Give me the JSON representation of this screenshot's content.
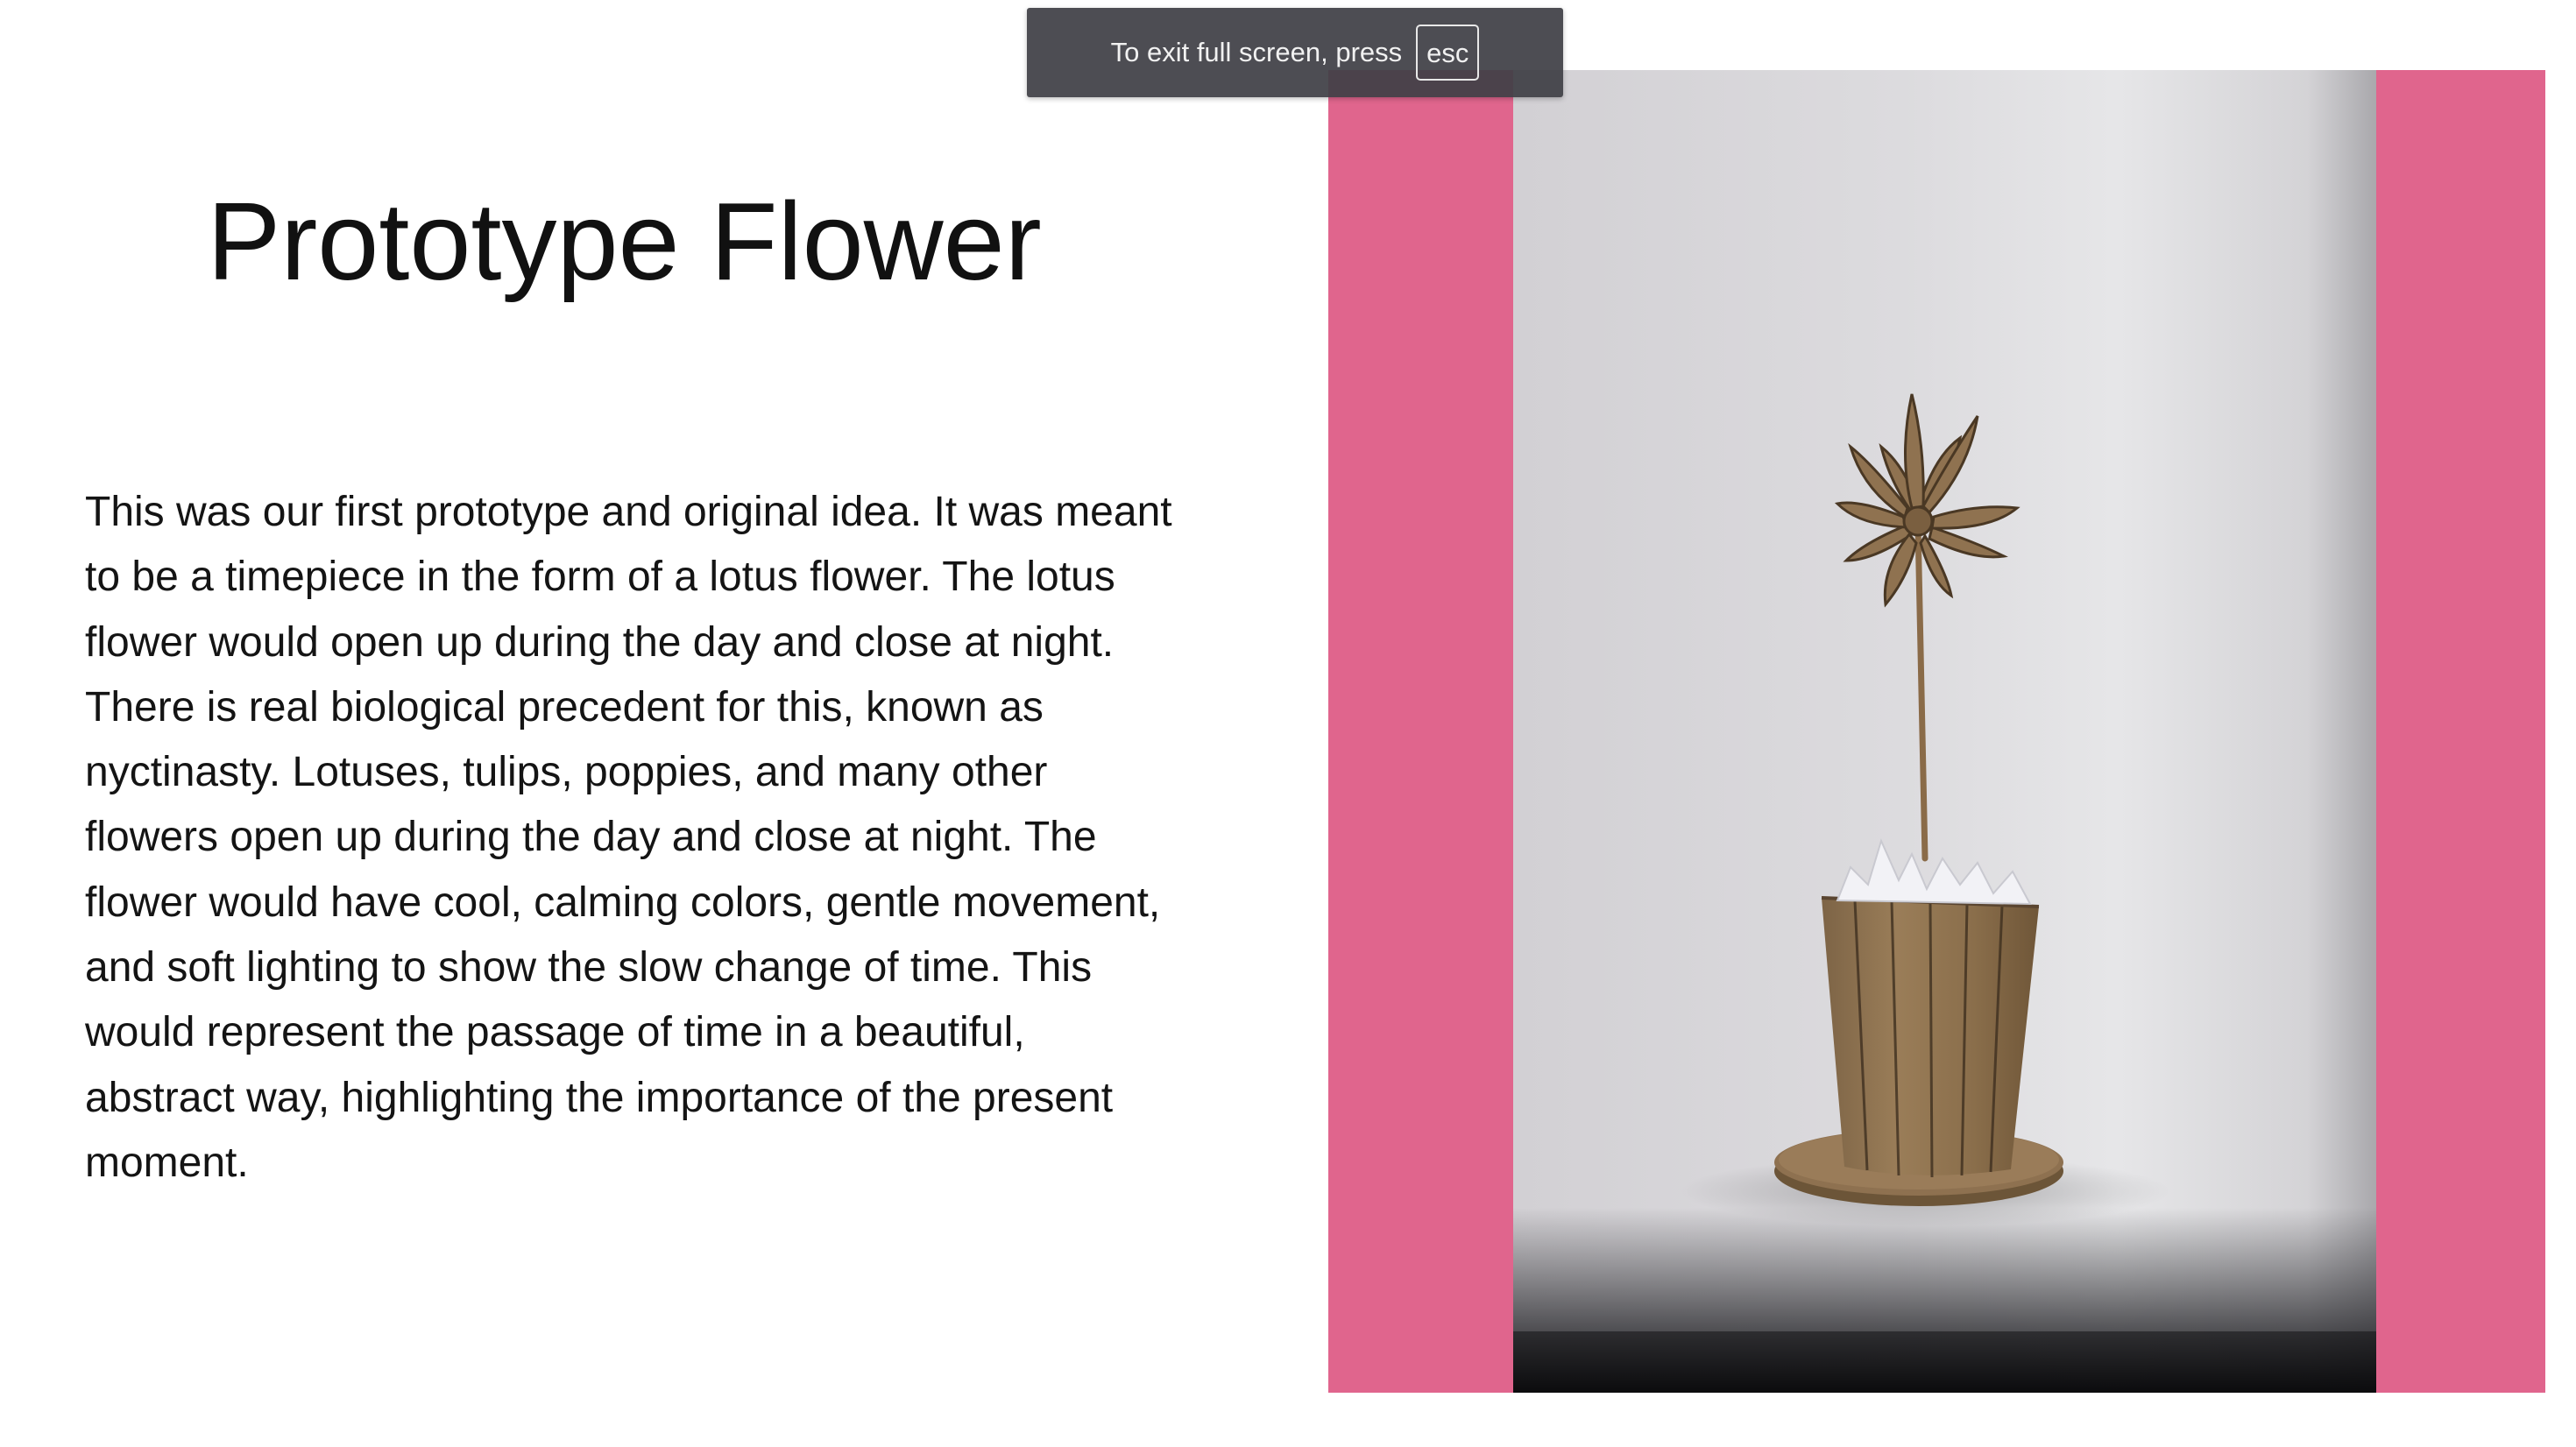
{
  "slide": {
    "title": "Prototype Flower",
    "body": "This was our first prototype and original idea. It was meant\nto be a timepiece in the form of a lotus flower. The lotus\nflower would open up during the day and close at night.\nThere is real biological precedent for this, known as\nnyctinasty. Lotuses, tulips, poppies, and many other\nflowers open up during the day and close at night. The\nflower would have cool, calming colors, gentle movement,\nand soft lighting to show the slow change of time. This\nwould represent the passage of time in a beautiful,\nabstract way, highlighting the importance of the present\nmoment.",
    "image_icon": "cardboard-flower-photo",
    "frame_color": "#e0658d"
  },
  "fullscreen_notice": {
    "text": "To exit full screen, press",
    "key": "esc"
  }
}
